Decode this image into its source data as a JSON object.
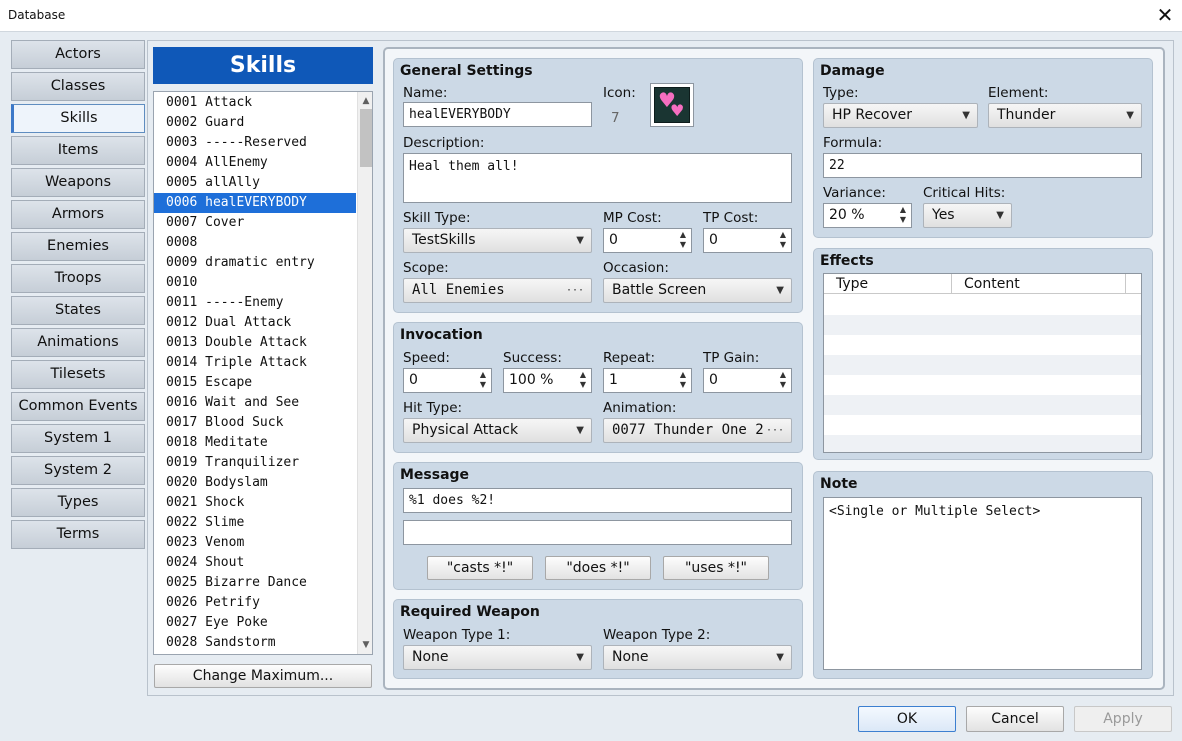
{
  "window": {
    "title": "Database",
    "close": "✕"
  },
  "categories": [
    "Actors",
    "Classes",
    "Skills",
    "Items",
    "Weapons",
    "Armors",
    "Enemies",
    "Troops",
    "States",
    "Animations",
    "Tilesets",
    "Common Events",
    "System 1",
    "System 2",
    "Types",
    "Terms"
  ],
  "selected_category": "Skills",
  "list": {
    "title": "Skills",
    "items": [
      "0001 Attack",
      "0002 Guard",
      "0003 -----Reserved",
      "0004 AllEnemy",
      "0005 allAlly",
      "0006 healEVERYBODY",
      "0007 Cover",
      "0008",
      "0009 dramatic entry",
      "0010",
      "0011 -----Enemy",
      "0012 Dual Attack",
      "0013 Double Attack",
      "0014 Triple Attack",
      "0015 Escape",
      "0016 Wait and See",
      "0017 Blood Suck",
      "0018 Meditate",
      "0019 Tranquilizer",
      "0020 Bodyslam",
      "0021 Shock",
      "0022 Slime",
      "0023 Venom",
      "0024 Shout",
      "0025 Bizarre Dance",
      "0026 Petrify",
      "0027 Eye Poke",
      "0028 Sandstorm"
    ],
    "selected": "0006 healEVERYBODY",
    "change_max": "Change Maximum..."
  },
  "general": {
    "title": "General Settings",
    "name_label": "Name:",
    "name_value": "healEVERYBODY",
    "icon_label": "Icon:",
    "icon_index": "7",
    "desc_label": "Description:",
    "desc_value": "Heal them all!",
    "skill_type_label": "Skill Type:",
    "skill_type_value": "TestSkills",
    "mp_label": "MP Cost:",
    "mp_value": "0",
    "tp_label": "TP Cost:",
    "tp_value": "0",
    "scope_label": "Scope:",
    "scope_value": "All Enemies",
    "occasion_label": "Occasion:",
    "occasion_value": "Battle Screen"
  },
  "invocation": {
    "title": "Invocation",
    "speed_label": "Speed:",
    "speed_value": "0",
    "success_label": "Success:",
    "success_value": "100 %",
    "repeat_label": "Repeat:",
    "repeat_value": "1",
    "tpgain_label": "TP Gain:",
    "tpgain_value": "0",
    "hit_label": "Hit Type:",
    "hit_value": "Physical Attack",
    "anim_label": "Animation:",
    "anim_value": "0077 Thunder One 2"
  },
  "message": {
    "title": "Message",
    "line1": "%1 does %2!",
    "line2": "",
    "btn_casts": "\"casts *!\"",
    "btn_does": "\"does *!\"",
    "btn_uses": "\"uses *!\""
  },
  "weapon": {
    "title": "Required Weapon",
    "t1_label": "Weapon Type 1:",
    "t1_value": "None",
    "t2_label": "Weapon Type 2:",
    "t2_value": "None"
  },
  "damage": {
    "title": "Damage",
    "type_label": "Type:",
    "type_value": "HP Recover",
    "element_label": "Element:",
    "element_value": "Thunder",
    "formula_label": "Formula:",
    "formula_value": "22",
    "variance_label": "Variance:",
    "variance_value": "20 %",
    "crit_label": "Critical Hits:",
    "crit_value": "Yes"
  },
  "effects": {
    "title": "Effects",
    "col_type": "Type",
    "col_content": "Content"
  },
  "note": {
    "title": "Note",
    "value": "<Single or Multiple Select>"
  },
  "footer": {
    "ok": "OK",
    "cancel": "Cancel",
    "apply": "Apply"
  },
  "colors": {
    "accent": "#0f58b8",
    "selection": "#1e6fd9",
    "group_bg": "#ccd9e6"
  },
  "icons": {
    "arrow": "▼",
    "spin_up": "▲",
    "spin_down": "▼",
    "ellipsis": "···",
    "heart": "♥"
  }
}
